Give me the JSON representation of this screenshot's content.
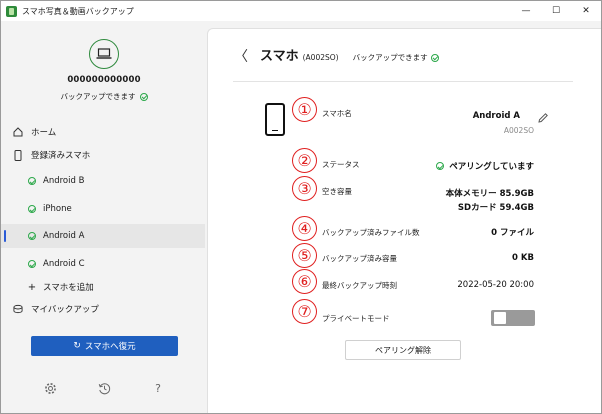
{
  "window": {
    "title": "スマホ写真＆動画バックアップ",
    "minimize": "—",
    "maximize": "☐",
    "close": "✕"
  },
  "sidebar": {
    "device_id": "000000000000",
    "device_status": "バックアップできます",
    "home_label": "ホーム",
    "registered_label": "登録済みスマホ",
    "phones": [
      {
        "label": "Android B"
      },
      {
        "label": "iPhone"
      },
      {
        "label": "Android A"
      },
      {
        "label": "Android C"
      }
    ],
    "add_phone_label": "スマホを追加",
    "my_backup_label": "マイバックアップ",
    "restore_button": "スマホへ復元",
    "settings_icon": "gear-icon",
    "history_icon": "history-icon",
    "help_icon": "?"
  },
  "main": {
    "back": "〈",
    "title": "スマホ",
    "model": "(A002SO)",
    "status": "バックアップできます",
    "rows": [
      {
        "num": "①",
        "label": "スマホ名",
        "value": "Android A",
        "sub": "A002SO"
      },
      {
        "num": "②",
        "label": "ステータス",
        "value": "ペアリングしています"
      },
      {
        "num": "③",
        "label": "空き容量",
        "value": "本体メモリー 85.9GB",
        "value2": "SDカード 59.4GB"
      },
      {
        "num": "④",
        "label": "バックアップ済みファイル数",
        "value": "0 ファイル"
      },
      {
        "num": "⑤",
        "label": "バックアップ済み容量",
        "value": "0 KB"
      },
      {
        "num": "⑥",
        "label": "最終バックアップ時刻",
        "value": "2022-05-20 20:00"
      },
      {
        "num": "⑦",
        "label": "プライベートモード"
      }
    ],
    "private_mode_on": false,
    "unpair_button": "ペアリング解除"
  }
}
